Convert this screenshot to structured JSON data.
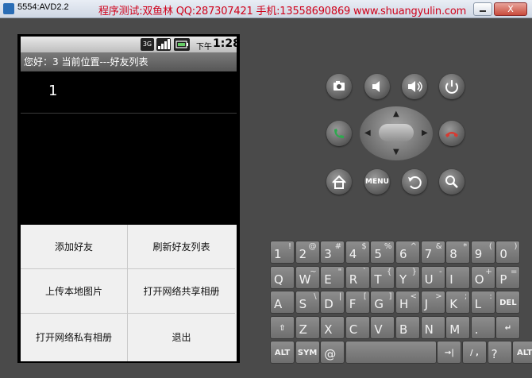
{
  "window": {
    "title": "5554:AVD2.2",
    "banner": "程序测试:双鱼林 QQ:287307421 手机:13558690869 www.shuangyulin.com",
    "close_label": "X"
  },
  "statusbar": {
    "network": "3G",
    "ampm": "下午",
    "time": "1:28"
  },
  "appbar": {
    "text": "您好：3   当前位置---好友列表"
  },
  "list": {
    "items": [
      "1"
    ]
  },
  "menu": {
    "items": [
      "添加好友",
      "刷新好友列表",
      "上传本地图片",
      "打开网络共享相册",
      "打开网络私有相册",
      "退出"
    ]
  },
  "controls": {
    "camera_icon": "camera-icon",
    "vol_down_icon": "volume-down-icon",
    "vol_up_icon": "volume-up-icon",
    "power_icon": "power-icon",
    "call_icon": "call-icon",
    "endcall_icon": "end-call-icon",
    "home_icon": "home-icon",
    "menu_label": "MENU",
    "back_icon": "back-icon",
    "search_icon": "search-icon"
  },
  "keyboard": {
    "row1": [
      [
        "1",
        "!"
      ],
      [
        "2",
        "@"
      ],
      [
        "3",
        "#"
      ],
      [
        "4",
        "$"
      ],
      [
        "5",
        "%"
      ],
      [
        "6",
        "^"
      ],
      [
        "7",
        "&"
      ],
      [
        "8",
        "*"
      ],
      [
        "9",
        "("
      ],
      [
        "0",
        ")"
      ]
    ],
    "row2": [
      [
        "Q",
        ""
      ],
      [
        "W",
        "~"
      ],
      [
        "E",
        "\""
      ],
      [
        "R",
        "`"
      ],
      [
        "T",
        "{"
      ],
      [
        "Y",
        "}"
      ],
      [
        "U",
        "-"
      ],
      [
        "I",
        ""
      ],
      [
        "O",
        "+"
      ],
      [
        "P",
        "="
      ]
    ],
    "row3": [
      [
        "A",
        ""
      ],
      [
        "S",
        "\\"
      ],
      [
        "D",
        "|"
      ],
      [
        "F",
        "["
      ],
      [
        "G",
        "]"
      ],
      [
        "H",
        "<"
      ],
      [
        "J",
        ">"
      ],
      [
        "K",
        ";"
      ],
      [
        "L",
        ":"
      ],
      [
        "DEL",
        ""
      ]
    ],
    "row4": [
      [
        "⇧",
        ""
      ],
      [
        "Z",
        ""
      ],
      [
        "X",
        ""
      ],
      [
        "C",
        ""
      ],
      [
        "V",
        ""
      ],
      [
        "B",
        ""
      ],
      [
        "N",
        ""
      ],
      [
        "M",
        ""
      ],
      [
        ".",
        ""
      ],
      [
        "↵",
        ""
      ]
    ],
    "row5": [
      [
        "ALT",
        ""
      ],
      [
        "SYM",
        ""
      ],
      [
        "@",
        ""
      ],
      [
        "",
        ""
      ],
      [
        "→|",
        ""
      ],
      [
        "/ ,",
        ""
      ],
      [
        "?",
        ""
      ],
      [
        "ALT",
        ""
      ]
    ]
  }
}
